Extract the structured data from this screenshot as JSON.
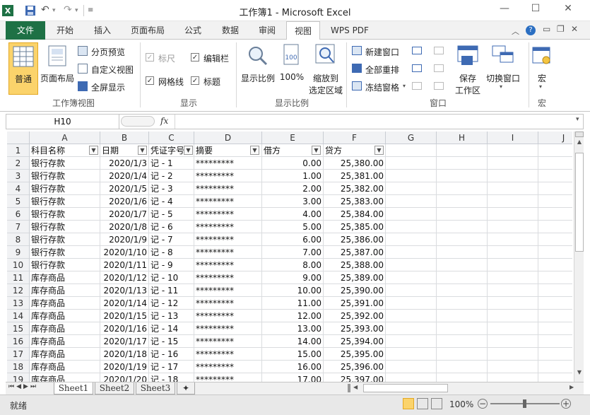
{
  "window": {
    "title": "工作簿1 - Microsoft Excel",
    "controls": [
      "—",
      "☐",
      "✕"
    ]
  },
  "ribbon_tabs": [
    "文件",
    "开始",
    "插入",
    "页面布局",
    "公式",
    "数据",
    "审阅",
    "视图",
    "WPS PDF"
  ],
  "ribbon_groups": {
    "workbook_views": {
      "label": "工作簿视图",
      "normal": "普通",
      "page_layout": "页面布局",
      "page_break": "分页预览",
      "custom_view": "自定义视图",
      "full_screen": "全屏显示"
    },
    "show": {
      "label": "显示",
      "ruler": "标尺",
      "formula_bar": "编辑栏",
      "gridlines": "网格线",
      "headings": "标题"
    },
    "zoom": {
      "label": "显示比例",
      "zoom": "显示比例",
      "zoom100": "100%",
      "zoom_selection_1": "缩放到",
      "zoom_selection_2": "选定区域"
    },
    "window": {
      "label": "窗口",
      "new_window": "新建窗口",
      "arrange_all": "全部重排",
      "freeze_panes": "冻结窗格",
      "save_workspace_1": "保存",
      "save_workspace_2": "工作区",
      "switch_windows": "切换窗口"
    },
    "macros": {
      "label": "宏",
      "macros": "宏"
    }
  },
  "formula_bar": {
    "name_box": "H10",
    "fx": "fx",
    "value": ""
  },
  "grid": {
    "columns": [
      "A",
      "B",
      "C",
      "D",
      "E",
      "F",
      "G",
      "H",
      "I",
      "J"
    ],
    "headers": [
      "科目名称",
      "日期",
      "凭证字号",
      "摘要",
      "借方",
      "贷方"
    ],
    "rows": [
      {
        "n": "2",
        "a": "银行存款",
        "b": "2020/1/3",
        "c": "记 - 1",
        "d": "*********",
        "e": "0.00",
        "f": "25,380.00"
      },
      {
        "n": "3",
        "a": "银行存款",
        "b": "2020/1/4",
        "c": "记 - 2",
        "d": "*********",
        "e": "1.00",
        "f": "25,381.00"
      },
      {
        "n": "4",
        "a": "银行存款",
        "b": "2020/1/5",
        "c": "记 - 3",
        "d": "*********",
        "e": "2.00",
        "f": "25,382.00"
      },
      {
        "n": "5",
        "a": "银行存款",
        "b": "2020/1/6",
        "c": "记 - 4",
        "d": "*********",
        "e": "3.00",
        "f": "25,383.00"
      },
      {
        "n": "6",
        "a": "银行存款",
        "b": "2020/1/7",
        "c": "记 - 5",
        "d": "*********",
        "e": "4.00",
        "f": "25,384.00"
      },
      {
        "n": "7",
        "a": "银行存款",
        "b": "2020/1/8",
        "c": "记 - 6",
        "d": "*********",
        "e": "5.00",
        "f": "25,385.00"
      },
      {
        "n": "8",
        "a": "银行存款",
        "b": "2020/1/9",
        "c": "记 - 7",
        "d": "*********",
        "e": "6.00",
        "f": "25,386.00"
      },
      {
        "n": "9",
        "a": "银行存款",
        "b": "2020/1/10",
        "c": "记 - 8",
        "d": "*********",
        "e": "7.00",
        "f": "25,387.00"
      },
      {
        "n": "10",
        "a": "银行存款",
        "b": "2020/1/11",
        "c": "记 - 9",
        "d": "*********",
        "e": "8.00",
        "f": "25,388.00"
      },
      {
        "n": "11",
        "a": "库存商品",
        "b": "2020/1/12",
        "c": "记 - 10",
        "d": "*********",
        "e": "9.00",
        "f": "25,389.00"
      },
      {
        "n": "12",
        "a": "库存商品",
        "b": "2020/1/13",
        "c": "记 - 11",
        "d": "*********",
        "e": "10.00",
        "f": "25,390.00"
      },
      {
        "n": "13",
        "a": "库存商品",
        "b": "2020/1/14",
        "c": "记 - 12",
        "d": "*********",
        "e": "11.00",
        "f": "25,391.00"
      },
      {
        "n": "14",
        "a": "库存商品",
        "b": "2020/1/15",
        "c": "记 - 13",
        "d": "*********",
        "e": "12.00",
        "f": "25,392.00"
      },
      {
        "n": "15",
        "a": "库存商品",
        "b": "2020/1/16",
        "c": "记 - 14",
        "d": "*********",
        "e": "13.00",
        "f": "25,393.00"
      },
      {
        "n": "16",
        "a": "库存商品",
        "b": "2020/1/17",
        "c": "记 - 15",
        "d": "*********",
        "e": "14.00",
        "f": "25,394.00"
      },
      {
        "n": "17",
        "a": "库存商品",
        "b": "2020/1/18",
        "c": "记 - 16",
        "d": "*********",
        "e": "15.00",
        "f": "25,395.00"
      },
      {
        "n": "18",
        "a": "库存商品",
        "b": "2020/1/19",
        "c": "记 - 17",
        "d": "*********",
        "e": "16.00",
        "f": "25,396.00"
      },
      {
        "n": "19",
        "a": "库存商品",
        "b": "2020/1/20",
        "c": "记 - 18",
        "d": "*********",
        "e": "17.00",
        "f": "25,397.00"
      }
    ]
  },
  "sheet_tabs": [
    "Sheet1",
    "Sheet2",
    "Sheet3"
  ],
  "status": {
    "ready": "就绪",
    "zoom": "100%"
  },
  "colors": {
    "file_tab": "#1e7145",
    "selected_button": "#fbd36b"
  }
}
